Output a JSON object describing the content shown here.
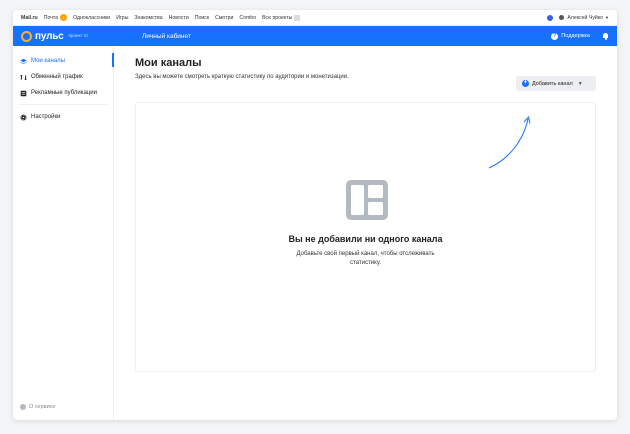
{
  "portal": {
    "brand": "Mail.ru",
    "links": [
      "Почта",
      "Одноклассники",
      "Игры",
      "Знакомства",
      "Новости",
      "Поиск",
      "Смотри",
      "Combo",
      "Все проекты"
    ],
    "mail_badge": "1",
    "user": "Алексей Чуйко"
  },
  "header": {
    "logo": "пульс",
    "logo_sub": "проект",
    "title": "Личный кабинет",
    "support": "Поддержка",
    "accent": "#1870ff"
  },
  "sidebar": {
    "items": [
      {
        "label": "Мои каналы",
        "icon": "layers-icon",
        "active": true
      },
      {
        "label": "Обменный трафик",
        "icon": "exchange-icon",
        "active": false
      },
      {
        "label": "Рекламные публикации",
        "icon": "document-icon",
        "active": false
      }
    ],
    "settings": "Настройки",
    "about": "О сервисе"
  },
  "main": {
    "title": "Мои каналы",
    "subtitle": "Здесь вы можете смотреть краткую статистику по аудитории и монетизации.",
    "add_button": "Добавить канал",
    "empty_title": "Вы не добавили ни одного канала",
    "empty_line1": "Добавьте свой первый канал, чтобы отслеживать",
    "empty_line2": "статистику."
  }
}
